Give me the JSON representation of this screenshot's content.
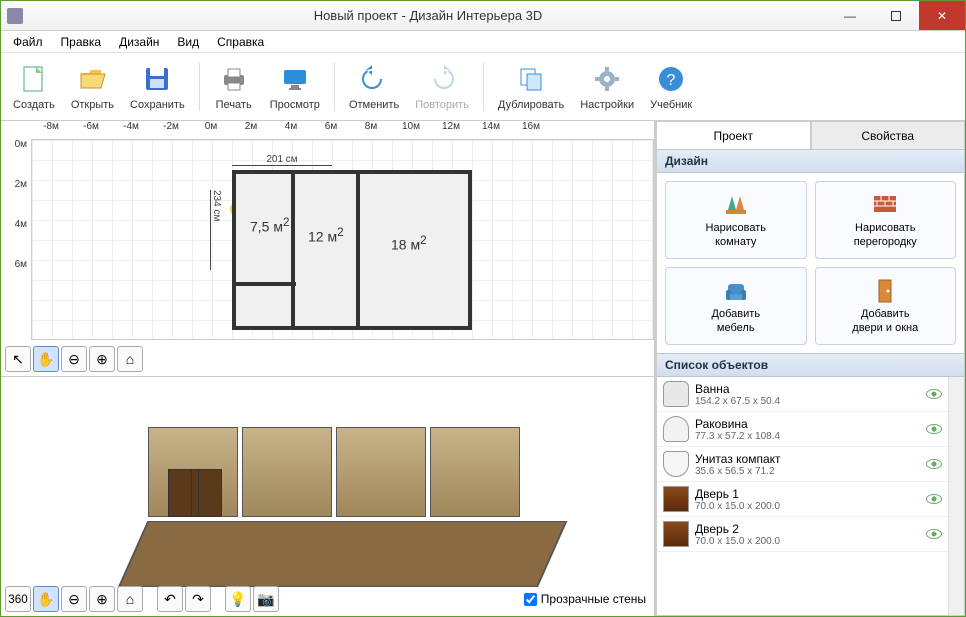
{
  "title": "Новый проект - Дизайн Интерьера 3D",
  "menu": {
    "file": "Файл",
    "edit": "Правка",
    "design": "Дизайн",
    "view": "Вид",
    "help": "Справка"
  },
  "toolbar": {
    "create": "Создать",
    "open": "Открыть",
    "save": "Сохранить",
    "print": "Печать",
    "preview": "Просмотр",
    "undo": "Отменить",
    "redo": "Повторить",
    "dup": "Дублировать",
    "settings": "Настройки",
    "tutor": "Учебник"
  },
  "ruler_h": [
    "-8м",
    "-6м",
    "-4м",
    "-2м",
    "0м",
    "2м",
    "4м",
    "6м",
    "8м",
    "10м",
    "12м",
    "14м",
    "16м"
  ],
  "ruler_v": [
    "0м",
    "2м",
    "4м",
    "6м"
  ],
  "floor": {
    "dim_h": "201 см",
    "dim_v": "234 см",
    "room1": "7,5 м",
    "room2": "12 м",
    "room3": "18 м",
    "sq": "2"
  },
  "checkbox": "Прозрачные стены",
  "tabs": {
    "project": "Проект",
    "props": "Свойства"
  },
  "section_design": "Дизайн",
  "design_buttons": {
    "draw_room": "Нарисовать\nкомнату",
    "draw_wall": "Нарисовать\nперегородку",
    "add_furn": "Добавить\nмебель",
    "add_door": "Добавить\nдвери и окна"
  },
  "section_objects": "Список объектов",
  "objects": [
    {
      "name": "Ванна",
      "size": "154.2 x 67.5 x 50.4",
      "kind": "bath"
    },
    {
      "name": "Раковина",
      "size": "77.3 x 57.2 x 108.4",
      "kind": "sink"
    },
    {
      "name": "Унитаз компакт",
      "size": "35.6 x 56.5 x 71.2",
      "kind": "toilet"
    },
    {
      "name": "Дверь 1",
      "size": "70.0 x 15.0 x 200.0",
      "kind": "door"
    },
    {
      "name": "Дверь 2",
      "size": "70.0 x 15.0 x 200.0",
      "kind": "door"
    }
  ]
}
